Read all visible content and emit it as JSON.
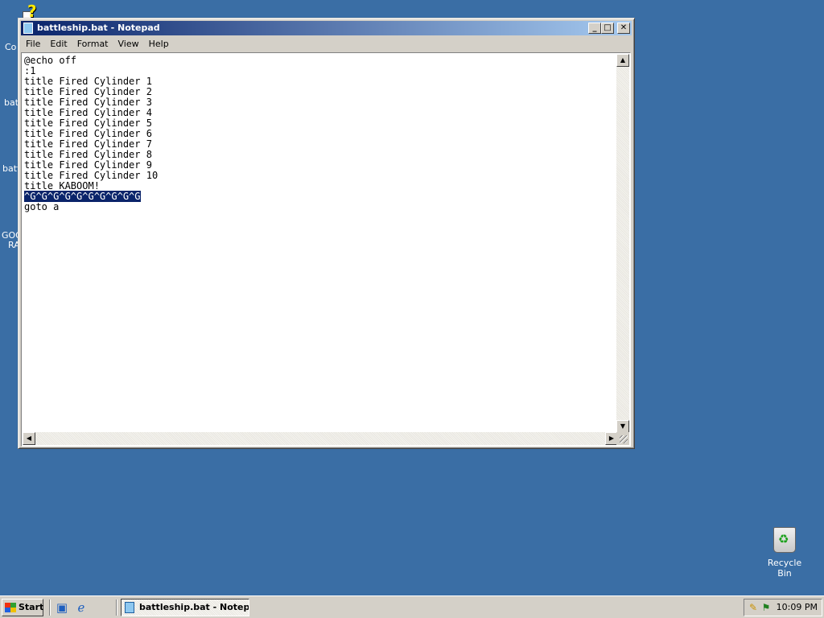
{
  "desktop": {
    "partial_labels": [
      "Co",
      "bat",
      "batt",
      "GOO",
      "RA"
    ],
    "recycle_bin": "Recycle Bin"
  },
  "window": {
    "title": "battleship.bat - Notepad",
    "minimize_glyph": "_",
    "maximize_glyph": "□",
    "close_glyph": "✕",
    "menu": {
      "file": "File",
      "edit": "Edit",
      "format": "Format",
      "view": "View",
      "help": "Help"
    },
    "lines": [
      "@echo off",
      ":1",
      "title Fired Cylinder 1",
      "title Fired Cylinder 2",
      "title Fired Cylinder 3",
      "title Fired Cylinder 4",
      "title Fired Cylinder 5",
      "title Fired Cylinder 6",
      "title Fired Cylinder 7",
      "title Fired Cylinder 8",
      "title Fired Cylinder 9",
      "title Fired Cylinder 10",
      "title KABOOM!",
      "^G^G^G^G^G^G^G^G^G^G",
      "goto a"
    ],
    "selected_line_index": 13
  },
  "taskbar": {
    "start_label": "Start",
    "task_label": "battleship.bat - Notep...",
    "clock": "10:09 PM"
  }
}
